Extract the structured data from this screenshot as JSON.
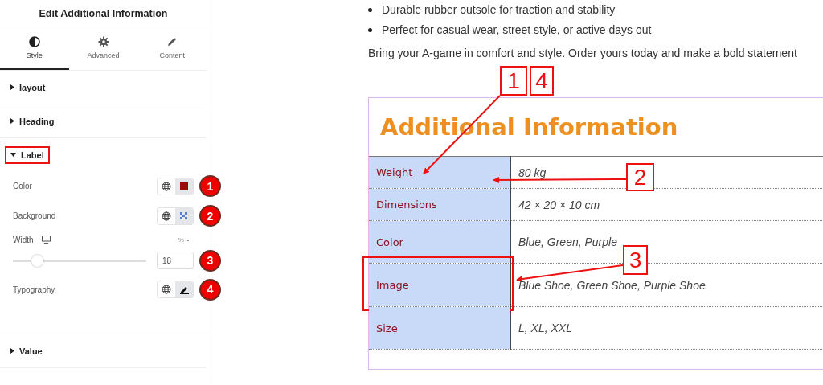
{
  "panel": {
    "title": "Edit Additional Information",
    "tabs": [
      {
        "label": "Style",
        "selected": true
      },
      {
        "label": "Advanced",
        "selected": false
      },
      {
        "label": "Content",
        "selected": false
      }
    ],
    "sections": [
      {
        "label": "layout",
        "expanded": false,
        "highlighted": false
      },
      {
        "label": "Heading",
        "expanded": false,
        "highlighted": false
      },
      {
        "label": "Label",
        "expanded": true,
        "highlighted": true,
        "controls": [
          {
            "kind": "color",
            "label": "Color",
            "badge": "1"
          },
          {
            "kind": "background",
            "label": "Background",
            "badge": "2"
          },
          {
            "kind": "slider",
            "label": "Width",
            "unit": "%",
            "level": 0.18,
            "value": "18",
            "badge": "3"
          },
          {
            "kind": "typography",
            "label": "Typography",
            "badge": "4"
          }
        ]
      },
      {
        "label": "Value",
        "expanded": false,
        "highlighted": false
      }
    ]
  },
  "content": {
    "bullets": [
      "Durable rubber outsole for traction and stability",
      "Perfect for casual wear, street style, or active days out"
    ],
    "paragraph": "Bring your A-game in comfort and style. Order yours today and make a bold statement",
    "heading": "Additional Information",
    "rows": [
      {
        "label": "Weight",
        "value": "80 kg",
        "highlighted": false
      },
      {
        "label": "Dimensions",
        "value": "42 × 20 × 10 cm",
        "highlighted": false
      },
      {
        "label": "Color",
        "value": "Blue, Green, Purple",
        "highlighted": false
      },
      {
        "label": "Image",
        "value": "Blue Shoe, Green Shoe, Purple Shoe",
        "highlighted": true
      },
      {
        "label": "Size",
        "value": "L, XL, XXL",
        "highlighted": false
      }
    ],
    "callouts": [
      {
        "text": "1"
      },
      {
        "text": "4"
      },
      {
        "text": "2"
      },
      {
        "text": "3"
      }
    ]
  }
}
